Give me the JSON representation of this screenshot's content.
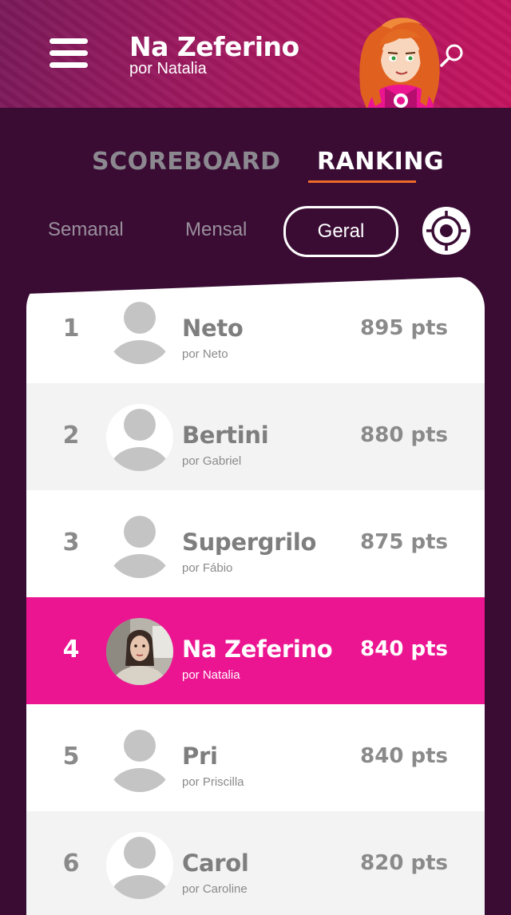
{
  "header": {
    "title": "Na Zeferino",
    "subtitle": "por Natalia",
    "menu_icon": "hamburger-menu-icon",
    "search_icon": "search-icon",
    "mascot": "superheroine-mascot"
  },
  "tabs": [
    {
      "label": "SCOREBOARD",
      "active": false
    },
    {
      "label": "RANKING",
      "active": true
    }
  ],
  "filters": [
    {
      "label": "Semanal",
      "active": false
    },
    {
      "label": "Mensal",
      "active": false
    },
    {
      "label": "Geral",
      "active": true
    }
  ],
  "target_icon": "target-icon",
  "colors": {
    "background": "#3a0c34",
    "highlight": "#ec1591",
    "tab_underline": "#f06a2a"
  },
  "ranking": [
    {
      "rank": "1",
      "name": "Neto",
      "by": "por Neto",
      "points": "895 pts"
    },
    {
      "rank": "2",
      "name": "Bertini",
      "by": "por Gabriel",
      "points": "880 pts"
    },
    {
      "rank": "3",
      "name": "Supergrilo",
      "by": "por Fábio",
      "points": "875 pts"
    },
    {
      "rank": "4",
      "name": "Na Zeferino",
      "by": "por Natalia",
      "points": "840 pts"
    },
    {
      "rank": "5",
      "name": "Pri",
      "by": "por Priscilla",
      "points": "840 pts"
    },
    {
      "rank": "6",
      "name": "Carol",
      "by": "por Caroline",
      "points": "820 pts"
    }
  ]
}
